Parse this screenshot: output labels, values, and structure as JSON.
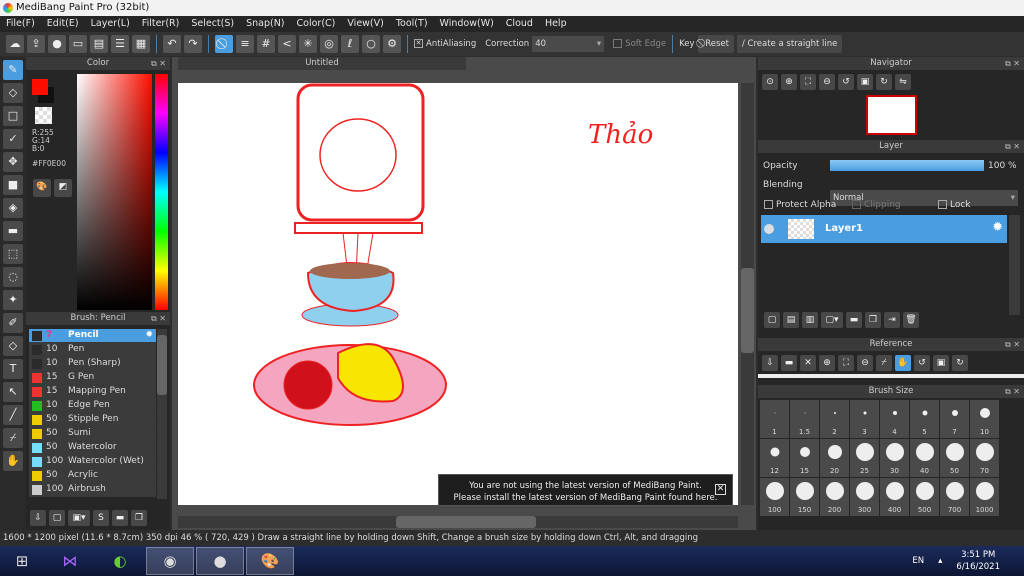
{
  "app": {
    "title": "MediBang Paint Pro (32bit)"
  },
  "menu": [
    "File(F)",
    "Edit(E)",
    "Layer(L)",
    "Filter(R)",
    "Select(S)",
    "Snap(N)",
    "Color(C)",
    "View(V)",
    "Tool(T)",
    "Window(W)",
    "Cloud",
    "Help"
  ],
  "toolbar": {
    "antialiasing_label": "AntiAliasing",
    "correction_label": "Correction",
    "correction_value": "40",
    "soft_edge_label": "Soft Edge",
    "key_label": "Key",
    "reset_label": "Reset",
    "straight_line_label": "Create a straight line"
  },
  "color": {
    "title": "Color",
    "r": "R:255",
    "g": "G:14",
    "b": "B:0",
    "hex": "#FF0E00",
    "foreground": "#ff0e00",
    "background": "#111111"
  },
  "brush": {
    "title": "Brush: Pencil",
    "items": [
      {
        "size": "7",
        "name": "Pencil",
        "color": "#2b2b2b"
      },
      {
        "size": "10",
        "name": "Pen",
        "color": "#2b2b2b"
      },
      {
        "size": "10",
        "name": "Pen (Sharp)",
        "color": "#2b2b2b"
      },
      {
        "size": "15",
        "name": "G Pen",
        "color": "#ee3333"
      },
      {
        "size": "15",
        "name": "Mapping Pen",
        "color": "#ee3333"
      },
      {
        "size": "10",
        "name": "Edge Pen",
        "color": "#22bb22"
      },
      {
        "size": "50",
        "name": "Stipple Pen",
        "color": "#eecc00"
      },
      {
        "size": "50",
        "name": "Sumi",
        "color": "#eecc00"
      },
      {
        "size": "50",
        "name": "Watercolor",
        "color": "#77ddf5"
      },
      {
        "size": "100",
        "name": "Watercolor (Wet)",
        "color": "#77ddf5"
      },
      {
        "size": "50",
        "name": "Acrylic",
        "color": "#eecc00"
      },
      {
        "size": "100",
        "name": "Airbrush",
        "color": "#cccccc"
      }
    ]
  },
  "canvas": {
    "tab": "Untitled",
    "signature": "Thảo"
  },
  "notice": {
    "line1": "You are not using the latest version of MediBang Paint.",
    "line2": "Please install the latest version of MediBang Paint found here."
  },
  "navigator": {
    "title": "Navigator"
  },
  "layer": {
    "title": "Layer",
    "opacity_label": "Opacity",
    "opacity_value": "100 %",
    "opacity": 100,
    "blending_label": "Blending",
    "blending_value": "Normal",
    "protect_alpha": "Protect Alpha",
    "clipping": "Clipping",
    "lock": "Lock",
    "layers": [
      {
        "name": "Layer1"
      }
    ]
  },
  "reference": {
    "title": "Reference"
  },
  "brush_size": {
    "title": "Brush Size",
    "sizes": [
      "1",
      "1.5",
      "2",
      "3",
      "4",
      "5",
      "7",
      "10",
      "12",
      "15",
      "20",
      "25",
      "30",
      "40",
      "50",
      "70",
      "100",
      "150",
      "200",
      "300",
      "400",
      "500",
      "700",
      "1000"
    ]
  },
  "status": {
    "pixels": "1600 * 1200 pixel",
    "cm": "(11.6 * 8.7cm)",
    "dpi": "350 dpi",
    "zoom": "46 %",
    "coords": "( 720, 429 )",
    "hint": "Draw a straight line by holding down Shift, Change a brush size by holding down Ctrl, Alt, and dragging"
  },
  "taskbar": {
    "lang": "EN",
    "time": "3:51 PM",
    "date": "6/16/2021"
  }
}
